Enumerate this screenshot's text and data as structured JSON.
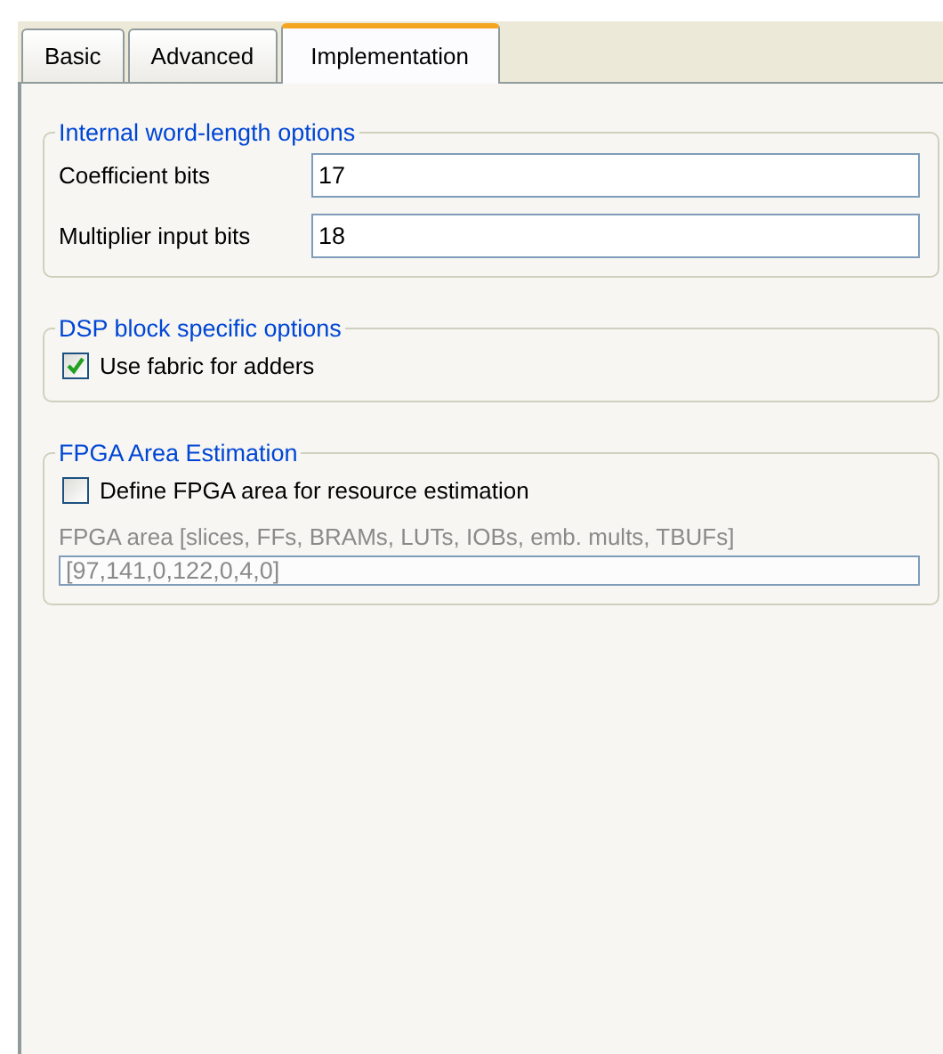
{
  "tabs": [
    {
      "label": "Basic",
      "selected": false
    },
    {
      "label": "Advanced",
      "selected": false
    },
    {
      "label": "Implementation",
      "selected": true
    }
  ],
  "groups": [
    {
      "title": "Internal word-length options",
      "items": [
        {
          "kind": "field",
          "label": "Coefficient bits",
          "value": "17"
        },
        {
          "kind": "field",
          "label": "Multiplier input bits",
          "value": "18"
        }
      ]
    },
    {
      "title": "DSP block specific options",
      "items": [
        {
          "kind": "checkbox",
          "label": "Use fabric for adders",
          "checked": true
        }
      ]
    },
    {
      "title": "FPGA Area Estimation",
      "items": [
        {
          "kind": "checkbox",
          "label": "Define FPGA area for resource estimation",
          "checked": false
        },
        {
          "kind": "stacked_field",
          "label": "FPGA area [slices, FFs, BRAMs, LUTs, IOBs, emb. mults, TBUFs]",
          "value": "[97,141,0,122,0,4,0]",
          "disabled": true
        }
      ]
    }
  ]
}
